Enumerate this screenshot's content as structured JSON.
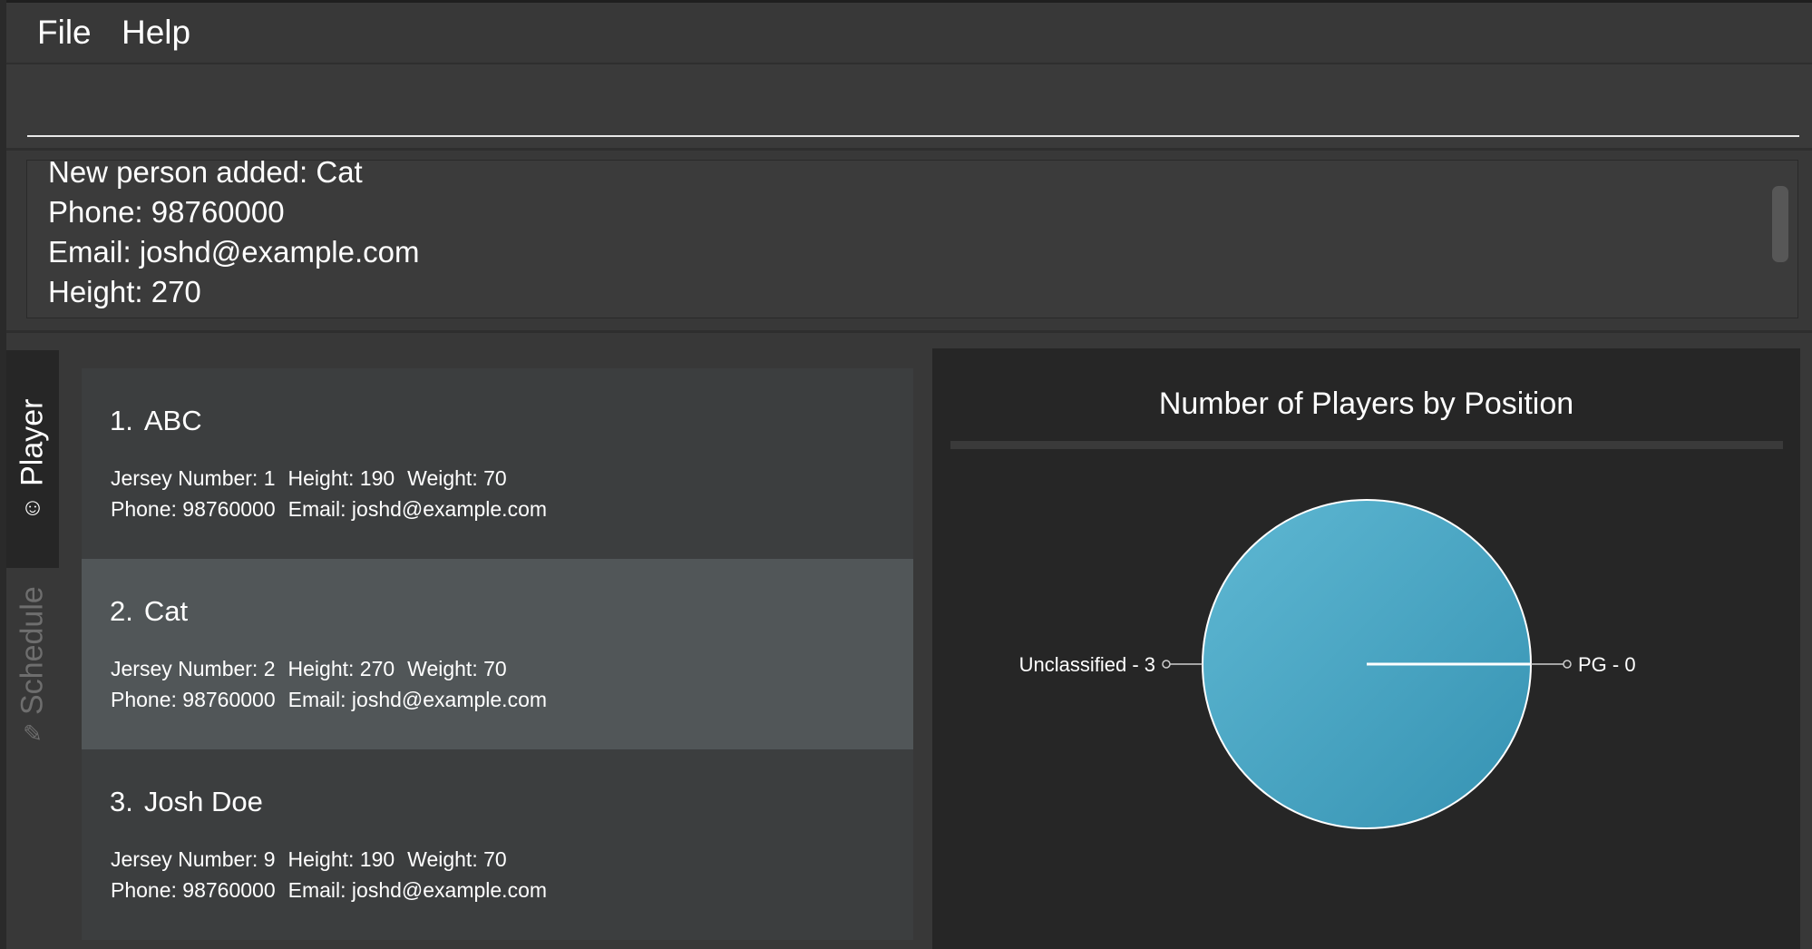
{
  "menu": {
    "file": "File",
    "help": "Help"
  },
  "command": {
    "value": "",
    "placeholder": ""
  },
  "result": {
    "lines": [
      "New person added: Cat",
      "Phone: 98760000",
      "Email: joshd@example.com",
      "Height: 270"
    ]
  },
  "tabs": [
    {
      "label": "Player",
      "icon": "smiley-icon",
      "active": true
    },
    {
      "label": "Schedule",
      "icon": "pencil-icon",
      "active": false
    }
  ],
  "players": [
    {
      "index": "1.",
      "name": "ABC",
      "jersey": "Jersey Number: 1",
      "height": "Height: 190",
      "weight": "Weight: 70",
      "phone": "Phone: 98760000",
      "email": "Email: joshd@example.com"
    },
    {
      "index": "2.",
      "name": "Cat",
      "jersey": "Jersey Number: 2",
      "height": "Height: 270",
      "weight": "Weight: 70",
      "phone": "Phone: 98760000",
      "email": "Email: joshd@example.com"
    },
    {
      "index": "3.",
      "name": "Josh Doe",
      "jersey": "Jersey Number: 9",
      "height": "Height: 190",
      "weight": "Weight: 70",
      "phone": "Phone: 98760000",
      "email": "Email: joshd@example.com"
    }
  ],
  "chart_data": {
    "type": "pie",
    "title": "Number of Players by Position",
    "slices": [
      {
        "label": "Unclassified - 3",
        "category": "Unclassified",
        "value": 3
      },
      {
        "label": "PG - 0",
        "category": "PG",
        "value": 0
      }
    ],
    "colors": {
      "slice": "#44a3c3",
      "line": "#ffffff"
    }
  }
}
